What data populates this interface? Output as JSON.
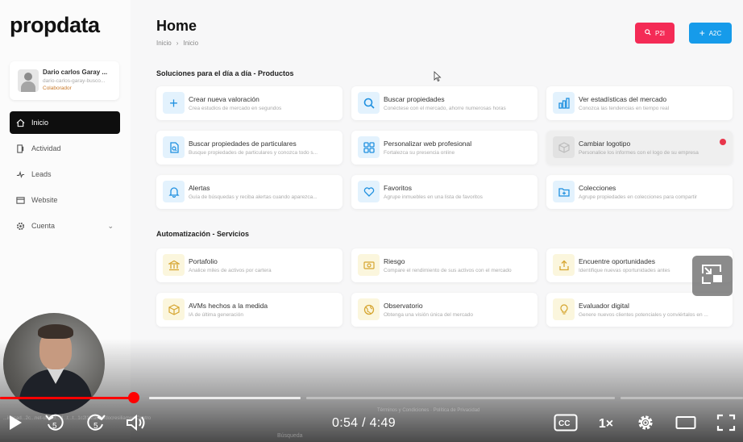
{
  "app": {
    "logo": "propdata"
  },
  "user": {
    "name": "Dario carlos Garay ...",
    "email": "dario-carlos-garay-busco...",
    "role": "Colaborador"
  },
  "sidebar": {
    "items": [
      {
        "label": "Inicio",
        "icon": "home-icon",
        "active": true
      },
      {
        "label": "Actividad",
        "icon": "activity-icon"
      },
      {
        "label": "Leads",
        "icon": "leads-icon"
      },
      {
        "label": "Website",
        "icon": "website-icon"
      },
      {
        "label": "Cuenta",
        "icon": "gear-icon",
        "expandable": true
      }
    ]
  },
  "header": {
    "title": "Home",
    "breadcrumb": [
      "Inicio",
      "Inicio"
    ],
    "buttons": [
      {
        "label": "P2I",
        "icon": "search-icon",
        "color": "#f42b56"
      },
      {
        "label": "A2C",
        "icon": "plus-icon",
        "color": "#169bea"
      }
    ]
  },
  "sections": [
    {
      "title": "Soluciones para el día a día - Productos",
      "cards": [
        {
          "title": "Crear nueva valoración",
          "desc": "Crea estudios de mercado en segundos",
          "icon": "plus-icon"
        },
        {
          "title": "Buscar propiedades",
          "desc": "Conéctese con el mercado, ahorre numerosas horas",
          "icon": "search-icon"
        },
        {
          "title": "Ver estadísticas del mercado",
          "desc": "Conozca las tendencias en tiempo real",
          "icon": "chart-icon"
        },
        {
          "title": "Buscar propiedades de particulares",
          "desc": "Busque propiedades de particulares y conozca todo s...",
          "icon": "document-search-icon"
        },
        {
          "title": "Personalizar web profesional",
          "desc": "Fortalezca su presencia online",
          "icon": "grid-icon"
        },
        {
          "title": "Cambiar logotipo",
          "desc": "Personalice los informes con el logo de su empresa",
          "icon": "cube-icon",
          "disabled": true,
          "badge": true
        },
        {
          "title": "Alertas",
          "desc": "Guía de búsquedas y reciba alertas cuando aparezca...",
          "icon": "bell-icon"
        },
        {
          "title": "Favoritos",
          "desc": "Agrupe inmuebles en una lista de favoritos",
          "icon": "heart-icon"
        },
        {
          "title": "Colecciones",
          "desc": "Agrupe propiedades en colecciones para compartir",
          "icon": "folder-plus-icon"
        }
      ]
    },
    {
      "title": "Automatización - Servicios",
      "cards": [
        {
          "title": "Portafolio",
          "desc": "Analice miles de activos por cartera",
          "icon": "bank-icon"
        },
        {
          "title": "Riesgo",
          "desc": "Compare el rendimiento de sus activos con el mercado",
          "icon": "money-icon"
        },
        {
          "title": "Encuentre oportunidades",
          "desc": "Identifique nuevas oportunidades antes",
          "icon": "upload-icon"
        },
        {
          "title": "AVMs hechos a la medida",
          "desc": "IA de última generación",
          "icon": "box-icon"
        },
        {
          "title": "Observatorio",
          "desc": "Obtenga una visión única del mercado",
          "icon": "globe-icon"
        },
        {
          "title": "Evaluador digital",
          "desc": "Genere nuevos clientes potenciales y conviértalos en ...",
          "icon": "bulb-icon"
        }
      ]
    }
  ],
  "video": {
    "time": "0:54 / 4:49",
    "speed": "1×",
    "progress_fraction": 0.187,
    "bg_text_left": "...inbcad...2c...net-url...ct...d...t...t...1c2l1f2a00Gdocresiliames-Centro",
    "bg_text_center": "Términos y Condiciones  ·  Política de Privacidad",
    "taskbar_search": "Búsqueda",
    "accent": "#ff0000"
  }
}
